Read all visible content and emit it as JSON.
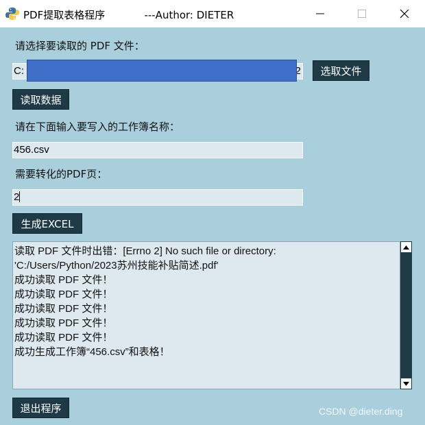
{
  "window": {
    "title": "PDF提取表格程序            ---Author: DIETER",
    "icon": "python-icon",
    "controls": [
      "minimize-icon",
      "maximize-icon",
      "close-icon"
    ]
  },
  "form": {
    "select_label": "请选择要读取的 PDF 文件：",
    "file_path_prefix": "C:",
    "file_path_suffix": "2",
    "select_button": "选取文件",
    "read_button": "读取数据",
    "workbook_label": "请在下面输入要写入的工作簿名称：",
    "workbook_value": "456.csv",
    "page_label": "需要转化的PDF页：",
    "page_value": "2",
    "generate_button": "生成EXCEL",
    "exit_button": "退出程序"
  },
  "log": {
    "lines": [
      "读取 PDF 文件时出错：[Errno 2] No such file or directory:",
      "'C:/Users/Python/2023苏州技能补贴简述.pdf'",
      "成功读取 PDF 文件！",
      "成功读取 PDF 文件！",
      "成功读取 PDF 文件！",
      "成功读取 PDF 文件！",
      "成功读取 PDF 文件！",
      "成功生成工作簿“456.csv”和表格！"
    ]
  },
  "watermark": "CSDN @dieter.ding",
  "colors": {
    "background": "#a9cfdc",
    "button": "#1f3a47",
    "entry": "#dde9ef",
    "redaction": "#3f6fc8"
  }
}
